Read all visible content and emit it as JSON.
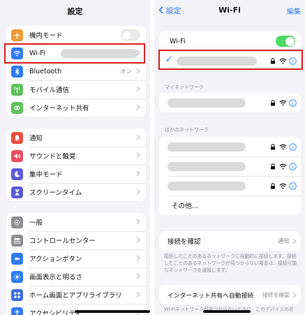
{
  "left": {
    "title": "設定",
    "group1": [
      {
        "icon": "airplane-icon",
        "color": "#f19a37",
        "label": "機内モード",
        "control": "toggle",
        "on": false
      },
      {
        "icon": "wifi-icon",
        "color": "#2f7bf5",
        "label": "Wi-Fi",
        "value": ""
      },
      {
        "icon": "bluetooth-icon",
        "color": "#2f7bf5",
        "label": "Bluetooth",
        "value": "オン"
      },
      {
        "icon": "antenna-icon",
        "color": "#5fc15a",
        "label": "モバイル通信",
        "value": ""
      },
      {
        "icon": "hotspot-icon",
        "color": "#5fc15a",
        "label": "インターネット共有",
        "value": ""
      }
    ],
    "group2": [
      {
        "icon": "bell-icon",
        "color": "#eb4d3d",
        "label": "通知"
      },
      {
        "icon": "speaker-icon",
        "color": "#eb4d60",
        "label": "サウンドと触覚"
      },
      {
        "icon": "moon-icon",
        "color": "#5b5bd6",
        "label": "集中モード"
      },
      {
        "icon": "hourglass-icon",
        "color": "#5b5bd6",
        "label": "スクリーンタイム"
      }
    ],
    "group3": [
      {
        "icon": "gear-icon",
        "color": "#8e8e93",
        "label": "一般"
      },
      {
        "icon": "control-center-icon",
        "color": "#8e8e93",
        "label": "コントロールセンター"
      },
      {
        "icon": "action-button-icon",
        "color": "#2f7bf5",
        "label": "アクションボタン"
      },
      {
        "icon": "sun-icon",
        "color": "#2f7bf5",
        "label": "画面表示と明るさ"
      },
      {
        "icon": "grid-icon",
        "color": "#3d6ee0",
        "label": "ホーム画面とアプリライブラリ"
      },
      {
        "icon": "accessibility-icon",
        "color": "#2f7bf5",
        "label": "アクセシビリティ"
      }
    ]
  },
  "right": {
    "back_label": "設定",
    "title": "Wi-Fi",
    "edit_label": "編集",
    "wifi_label": "Wi-Fi",
    "wifi_on": true,
    "my_networks_header": "マイネットワーク",
    "other_networks_header": "ほかのネットワーク",
    "other_label": "その他...",
    "ask_join_label": "接続を確認",
    "ask_join_value": "通知",
    "ask_join_note": "接続したことのあるネットワークに自動的に接続します。接続したことのあるネットワークが見つからない場合は、接続可能なネットワークを通知します。",
    "hotspot_label": "インターネット共有へ自動接続",
    "hotspot_value": "接続を確認",
    "hotspot_note": "Wi-Fiネットワークが見つからないときに、このデバイスの近"
  },
  "colors": {
    "accent": "#2f7bf5",
    "switch_on": "#4cd964",
    "highlight": "#d9231f"
  }
}
